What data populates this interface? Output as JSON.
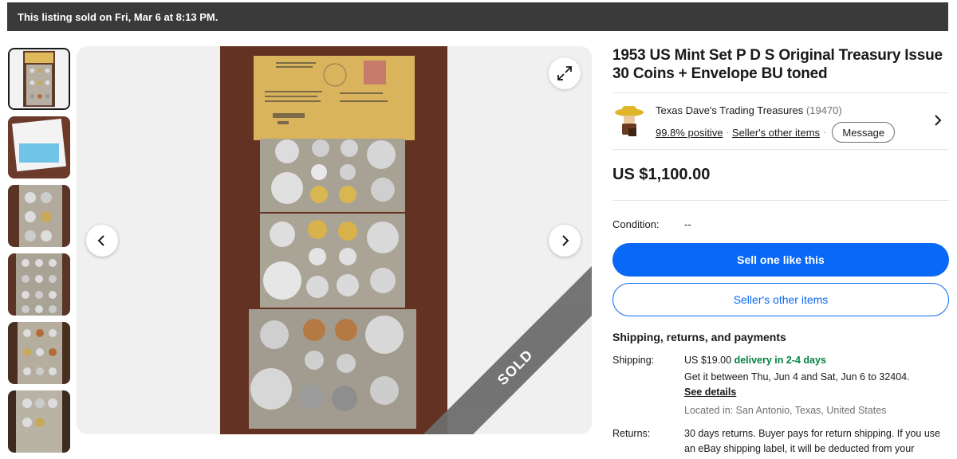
{
  "banner": {
    "text": "This listing sold on Fri, Mar 6 at 8:13 PM."
  },
  "gallery": {
    "sold_label": "SOLD",
    "prev_icon": "chevron-left-icon",
    "next_icon": "chevron-right-icon",
    "expand_icon": "expand-icon"
  },
  "listing": {
    "title": "1953 US Mint Set P D S Original Treasury Issue 30 Coins + Envelope BU toned",
    "price": "US $1,100.00",
    "condition_label": "Condition:",
    "condition_value": "--"
  },
  "seller": {
    "name": "Texas Dave's Trading Treasures",
    "feedback_count": "(19470)",
    "positive": "99.8% positive",
    "other_items": "Seller's other items",
    "message_button": "Message"
  },
  "actions": {
    "sell_one": "Sell one like this",
    "other_items": "Seller's other items"
  },
  "shipping": {
    "heading": "Shipping, returns, and payments",
    "shipping_label": "Shipping:",
    "shipping_cost": "US $19.00",
    "delivery": "delivery in 2-4 days",
    "estimate": "Get it between Thu, Jun 4 and Sat, Jun 6 to 32404.",
    "see_details": "See details",
    "located": "Located in: San Antonio, Texas, United States",
    "returns_label": "Returns:",
    "returns_text": "30 days returns. Buyer pays for return shipping. If you use an eBay shipping label, it will be deducted from your"
  },
  "colors": {
    "accent": "#0968f6",
    "green": "#05823f",
    "banner": "#3a3a3a"
  }
}
